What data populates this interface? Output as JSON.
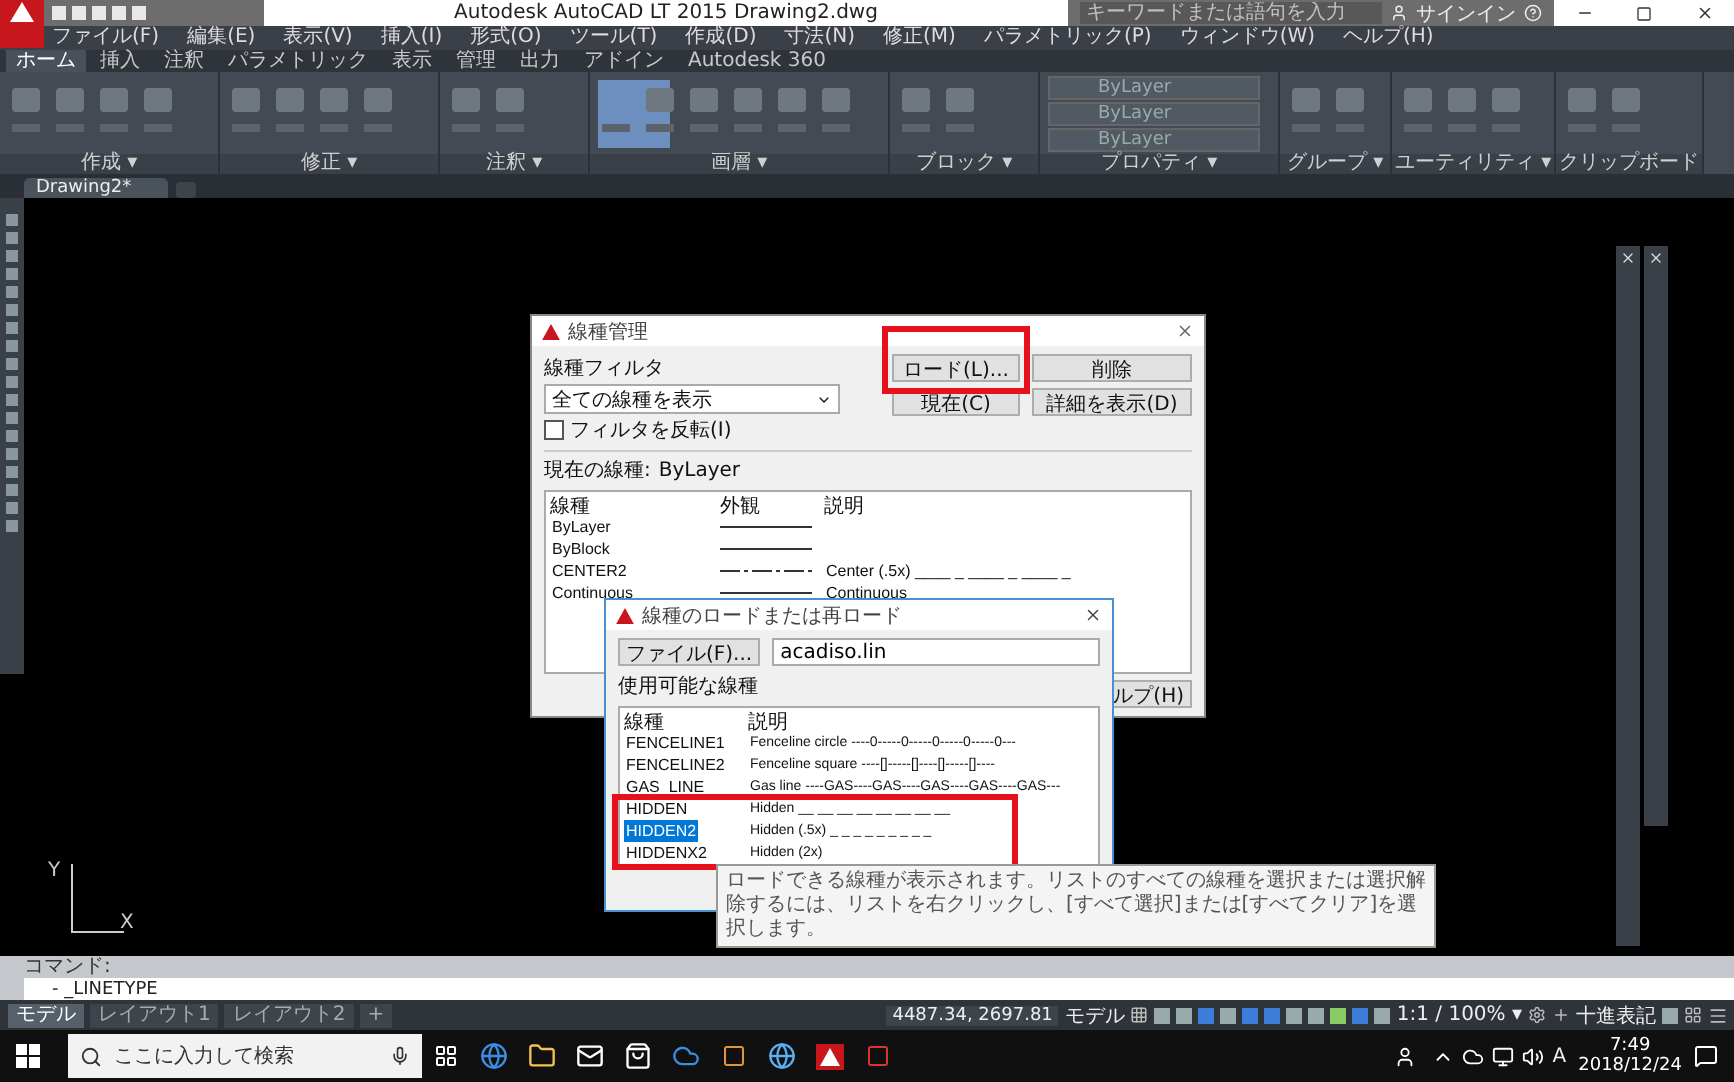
{
  "title_bar": {
    "title": "Autodesk AutoCAD LT 2015  Drawing2.dwg",
    "search": {
      "placeholder": "キーワードまたは語句を入力"
    },
    "sign_in": "サインイン"
  },
  "menu_bar": [
    "ファイル(F)",
    "編集(E)",
    "表示(V)",
    "挿入(I)",
    "形式(O)",
    "ツール(T)",
    "作成(D)",
    "寸法(N)",
    "修正(M)",
    "パラメトリック(P)",
    "ウィンドウ(W)",
    "ヘルプ(H)"
  ],
  "ribbon": {
    "tabs": [
      {
        "label": "ホーム",
        "selected": true
      },
      {
        "label": "挿入",
        "selected": false
      },
      {
        "label": "注釈",
        "selected": false
      },
      {
        "label": "パラメトリック",
        "selected": false
      },
      {
        "label": "表示",
        "selected": false
      },
      {
        "label": "管理",
        "selected": false
      },
      {
        "label": "出力",
        "selected": false
      },
      {
        "label": "アドイン",
        "selected": false
      },
      {
        "label": "Autodesk 360",
        "selected": false
      }
    ],
    "panels": [
      {
        "title": "作成 ▾"
      },
      {
        "title": "修正 ▾"
      },
      {
        "title": "注釈 ▾"
      },
      {
        "title": "画層 ▾"
      },
      {
        "title": "ブロック ▾"
      },
      {
        "title": "プロパティ ▾"
      },
      {
        "title": "グループ ▾"
      },
      {
        "title": "ユーティリティ ▾"
      },
      {
        "title": "クリップボード"
      }
    ],
    "property_combos": [
      "ByLayer",
      "ByLayer",
      "ByLayer"
    ]
  },
  "file_tabs": [
    {
      "label": "Drawing2*",
      "selected": true
    }
  ],
  "linetype_manager": {
    "title": "線種管理",
    "filter_label": "線種フィルタ",
    "filter_value": "全ての線種を表示",
    "invert_filter": {
      "label": "フィルタを反転(I)",
      "checked": false
    },
    "buttons": [
      "ロード(L)...",
      "削除",
      "現在(C)",
      "詳細を表示(D)"
    ],
    "current_label": "現在の線種:",
    "current_value": "ByLayer",
    "columns": [
      "線種",
      "外観",
      "説明"
    ],
    "rows": [
      {
        "name": "ByLayer",
        "kind": "solid",
        "description": ""
      },
      {
        "name": "ByBlock",
        "kind": "solid",
        "description": ""
      },
      {
        "name": "CENTER2",
        "kind": "center",
        "description": "Center (.5x) ____ _ ____ _ ____ _"
      },
      {
        "name": "Continuous",
        "kind": "solid",
        "description": "Continuous"
      }
    ],
    "help_button": "ルプ(H)"
  },
  "load_dialog": {
    "title": "線種のロードまたは再ロード",
    "file_button": "ファイル(F)...",
    "file_value": "acadiso.lin",
    "list_label": "使用可能な線種",
    "columns": [
      "線種",
      "説明"
    ],
    "rows": [
      {
        "name": "FENCELINE1",
        "description": "Fenceline circle ----0-----0-----0-----0-----0---",
        "selected": false
      },
      {
        "name": "FENCELINE2",
        "description": "Fenceline square ----[]-----[]----[]-----[]----",
        "selected": false
      },
      {
        "name": "GAS_LINE",
        "description": "Gas line ----GAS----GAS----GAS----GAS----GAS---",
        "selected": false
      },
      {
        "name": "HIDDEN",
        "description": "Hidden __ __ __ __ __ __ __ __",
        "selected": false
      },
      {
        "name": "HIDDEN2",
        "description": "Hidden (.5x) _ _ _ _ _ _ _ _ _",
        "selected": true
      },
      {
        "name": "HIDDENX2",
        "description": "Hidden (2x)",
        "selected": false
      }
    ],
    "tooltip": "ロードできる線種が表示されます。リストのすべての線種を選択または選択解除するには、リストを右クリックし、[すべて選択]または[すべてクリア]を選択します。"
  },
  "ucs": {
    "x": "X",
    "y": "Y"
  },
  "command_line": {
    "label": "コマンド:",
    "value": "- _LINETYPE"
  },
  "layout_tabs": [
    {
      "label": "モデル",
      "selected": true
    },
    {
      "label": "レイアウト1",
      "selected": false
    },
    {
      "label": "レイアウト2",
      "selected": false
    },
    {
      "label": "+",
      "selected": false
    }
  ],
  "status_bar": {
    "coordinates": "4487.34, 2697.81",
    "space": "モデル",
    "scale": "1:1 / 100% ▾",
    "units": "十進表記"
  },
  "taskbar": {
    "search_placeholder": "ここに入力して検索",
    "ime": "A",
    "time": "7:49",
    "date": "2018/12/24"
  }
}
